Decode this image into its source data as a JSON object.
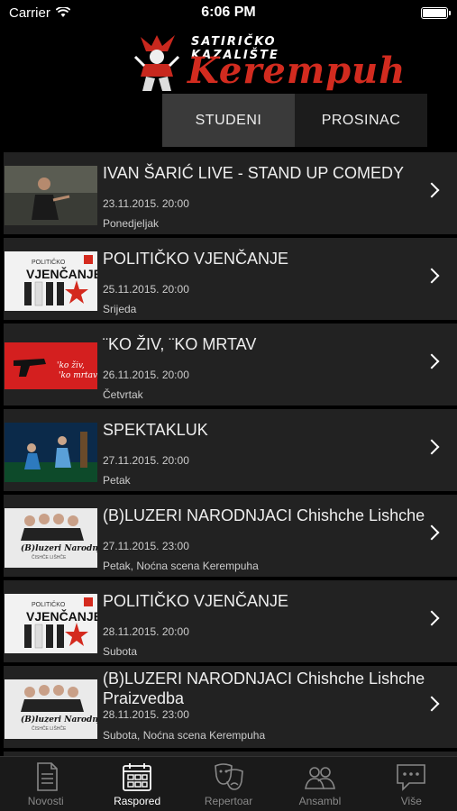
{
  "status": {
    "carrier": "Carrier",
    "time": "6:06 PM"
  },
  "logo": {
    "subtitle": "SATIRIČKO KAZALIŠTE",
    "name": "Kerempuh"
  },
  "tabs": [
    {
      "label": "STUDENI",
      "active": true
    },
    {
      "label": "PROSINAC",
      "active": false
    }
  ],
  "events": [
    {
      "title": "IVAN ŠARIĆ LIVE - STAND UP COMEDY",
      "date": "23.11.2015.  20:00",
      "day": "Ponedjeljak",
      "thumb": "stand-up-photo"
    },
    {
      "title": "POLITIČKO VJENČANJE",
      "date": "25.11.2015.  20:00",
      "day": "Srijeda",
      "thumb": "vjencanje-poster"
    },
    {
      "title": "¨KO ŽIV, ¨KO MRTAV",
      "date": "26.11.2015.  20:00",
      "day": "Četvrtak",
      "thumb": "ko-ziv-poster"
    },
    {
      "title": "SPEKTAKLUK",
      "date": "27.11.2015.  20:00",
      "day": "Petak",
      "thumb": "stage-photo"
    },
    {
      "title": "(B)LUZERI NARODNJACI  Chishche Lishche",
      "date": "27.11.2015.  23:00",
      "day": "Petak, Noćna scena Kerempuha",
      "thumb": "luzeri-poster"
    },
    {
      "title": "POLITIČKO VJENČANJE",
      "date": "28.11.2015.  20:00",
      "day": "Subota",
      "thumb": "vjencanje-poster"
    },
    {
      "title": "(B)LUZERI NARODNJACI Chishche Lishche Praizvedba",
      "date": "28.11.2015.  23:00",
      "day": "Subota, Noćna scena Kerempuha",
      "thumb": "luzeri-poster"
    }
  ],
  "tabbar": [
    {
      "label": "Novosti",
      "icon": "document-icon",
      "active": false
    },
    {
      "label": "Raspored",
      "icon": "calendar-icon",
      "active": true
    },
    {
      "label": "Repertoar",
      "icon": "theater-masks-icon",
      "active": false
    },
    {
      "label": "Ansambl",
      "icon": "people-icon",
      "active": false
    },
    {
      "label": "Više",
      "icon": "chat-more-icon",
      "active": false
    }
  ]
}
